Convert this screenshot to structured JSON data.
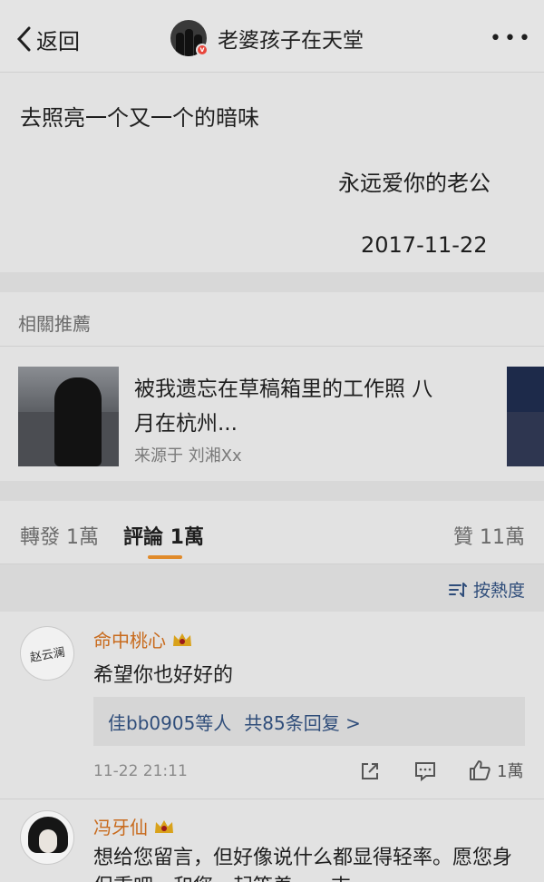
{
  "header": {
    "back_label": "返回",
    "title": "老婆孩子在天堂",
    "badge": "v",
    "more_label": "•••"
  },
  "post": {
    "line1": "去照亮一个又一个的暗味",
    "signature": "永远爱你的老公",
    "date": "2017-11-22"
  },
  "related": {
    "label": "相關推薦",
    "title": "被我遗忘在草稿箱里的工作照 八月在杭州...",
    "source": "来源于 刘湘Xx"
  },
  "tabs": {
    "repost": "轉發 1萬",
    "comment": "評論 1萬",
    "like": "贊 11萬"
  },
  "sort": {
    "label": "按熱度"
  },
  "comments": [
    {
      "name": "命中桃心",
      "avatar_text": "赵云澜",
      "text": "希望你也好好的",
      "replies_user": "佳bb0905等人",
      "replies_count": "共85条回复 >",
      "time": "11-22 21:11",
      "likes": "1萬"
    },
    {
      "name": "冯牙仙",
      "text": "想给您留言，但好像说什么都显得轻率。愿您身保重吧，和您一起等着......吉"
    }
  ],
  "colors": {
    "background": "#e2e2e2",
    "accent_orange": "#e08a2a",
    "username": "#c86a1c",
    "link_blue": "#2f4d7a",
    "crown": "#d9a21b"
  },
  "icons": [
    "chevron-left-icon",
    "more-icon",
    "verified-badge-icon",
    "sort-icon",
    "crown-icon",
    "share-icon",
    "comment-icon",
    "thumb-up-icon"
  ]
}
